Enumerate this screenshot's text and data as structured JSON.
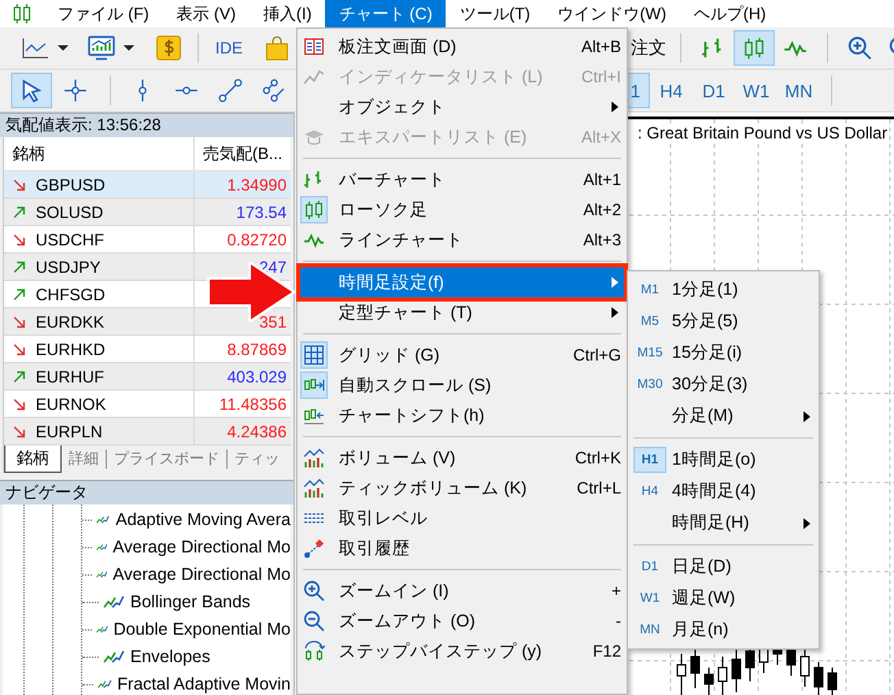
{
  "menu_bar": [
    {
      "label": "ファイル (F)",
      "selected": false
    },
    {
      "label": "表示 (V)",
      "selected": false
    },
    {
      "label": "挿入(I)",
      "selected": false
    },
    {
      "label": "チャート (C)",
      "selected": true
    },
    {
      "label": "ツール(T)",
      "selected": false
    },
    {
      "label": "ウインドウ(W)",
      "selected": false
    },
    {
      "label": "ヘルプ(H)",
      "selected": false
    }
  ],
  "toolbar": {
    "ide_label": "IDE",
    "order_label": "注文",
    "chart_types": [
      {
        "kind": "bar",
        "selected": false
      },
      {
        "kind": "candle",
        "selected": true
      },
      {
        "kind": "line",
        "selected": false
      }
    ]
  },
  "drawing_tools": [
    {
      "kind": "cursor",
      "selected": true
    },
    {
      "kind": "crosshair",
      "selected": false
    },
    {
      "kind": "vline",
      "selected": false
    },
    {
      "kind": "hline",
      "selected": false
    },
    {
      "kind": "trend",
      "selected": false
    },
    {
      "kind": "channel",
      "selected": false
    }
  ],
  "timeframes": [
    {
      "label": "1",
      "selected": true
    },
    {
      "label": "H4",
      "selected": false
    },
    {
      "label": "D1",
      "selected": false
    },
    {
      "label": "W1",
      "selected": false
    },
    {
      "label": "MN",
      "selected": false
    }
  ],
  "market_watch": {
    "title": "気配値表示: 13:56:28",
    "columns": [
      "銘柄",
      "売気配(B..."
    ],
    "rows": [
      {
        "symbol": "GBPUSD",
        "bid": "1.34990",
        "rising": false,
        "selected": true
      },
      {
        "symbol": "SOLUSD",
        "bid": "173.54",
        "rising": true,
        "selected": false
      },
      {
        "symbol": "USDCHF",
        "bid": "0.82720",
        "rising": false,
        "selected": false
      },
      {
        "symbol": "USDJPY",
        "bid": "247",
        "rising": true,
        "selected": false
      },
      {
        "symbol": "CHFSGD",
        "rising": true,
        "selected": false
      },
      {
        "symbol": "EURDKK",
        "bid": "351",
        "rising": false,
        "selected": false
      },
      {
        "symbol": "EURHKD",
        "bid": "8.87869",
        "rising": false,
        "selected": false
      },
      {
        "symbol": "EURHUF",
        "bid": "403.029",
        "rising": true,
        "selected": false
      },
      {
        "symbol": "EURNOK",
        "bid": "11.48356",
        "rising": false,
        "selected": false
      },
      {
        "symbol": "EURPLN",
        "bid": "4.24386",
        "rising": false,
        "selected": false
      }
    ],
    "tabs": [
      {
        "label": "銘柄",
        "selected": true
      },
      {
        "label": "詳細",
        "selected": false
      },
      {
        "label": "プライスボード",
        "selected": false
      },
      {
        "label": "ティッ",
        "selected": false
      }
    ]
  },
  "navigator": {
    "title": "ナビゲータ",
    "indicators": [
      "Adaptive Moving Avera",
      "Average Directional Mo",
      "Average Directional Mo",
      "Bollinger Bands",
      "Double Exponential Mo",
      "Envelopes",
      "Fractal Adaptive Movin"
    ]
  },
  "chart": {
    "title": ": Great Britain Pound vs US Dollar"
  },
  "chart_menu": [
    {
      "kind": "item",
      "label": "板注文画面 (D)",
      "shortcut": "Alt+B",
      "disabled": false,
      "checked": false,
      "submenu": false,
      "selected": false
    },
    {
      "kind": "item",
      "label": "インディケータリスト (L)",
      "shortcut": "Ctrl+I",
      "disabled": true,
      "checked": false,
      "submenu": false,
      "selected": false
    },
    {
      "kind": "item",
      "label": "オブジェクト",
      "disabled": false,
      "checked": false,
      "submenu": true,
      "selected": false
    },
    {
      "kind": "item",
      "label": "エキスパートリスト (E)",
      "shortcut": "Alt+X",
      "disabled": true,
      "checked": false,
      "submenu": false,
      "selected": false
    },
    {
      "kind": "separator"
    },
    {
      "kind": "item",
      "label": "バーチャート",
      "shortcut": "Alt+1",
      "disabled": false,
      "checked": false,
      "submenu": false,
      "selected": false
    },
    {
      "kind": "item",
      "label": "ローソク足",
      "shortcut": "Alt+2",
      "disabled": false,
      "checked": true,
      "submenu": false,
      "selected": false
    },
    {
      "kind": "item",
      "label": "ラインチャート",
      "shortcut": "Alt+3",
      "disabled": false,
      "checked": false,
      "submenu": false,
      "selected": false
    },
    {
      "kind": "separator"
    },
    {
      "kind": "item",
      "label": "時間足設定(f)",
      "disabled": false,
      "checked": false,
      "submenu": true,
      "selected": true,
      "annotated": true
    },
    {
      "kind": "item",
      "label": "定型チャート (T)",
      "disabled": false,
      "checked": false,
      "submenu": true,
      "selected": false
    },
    {
      "kind": "separator"
    },
    {
      "kind": "item",
      "label": "グリッド (G)",
      "shortcut": "Ctrl+G",
      "disabled": false,
      "checked": true,
      "submenu": false,
      "selected": false
    },
    {
      "kind": "item",
      "label": "自動スクロール (S)",
      "disabled": false,
      "checked": true,
      "submenu": false,
      "selected": false
    },
    {
      "kind": "item",
      "label": "チャートシフト(h)",
      "disabled": false,
      "checked": false,
      "submenu": false,
      "selected": false
    },
    {
      "kind": "separator"
    },
    {
      "kind": "item",
      "label": "ボリューム (V)",
      "shortcut": "Ctrl+K",
      "disabled": false,
      "checked": false,
      "submenu": false,
      "selected": false
    },
    {
      "kind": "item",
      "label": "ティックボリューム (K)",
      "shortcut": "Ctrl+L",
      "disabled": false,
      "checked": false,
      "submenu": false,
      "selected": false
    },
    {
      "kind": "item",
      "label": "取引レベル",
      "disabled": false,
      "checked": false,
      "submenu": false,
      "selected": false
    },
    {
      "kind": "item",
      "label": "取引履歴",
      "disabled": false,
      "checked": false,
      "submenu": false,
      "selected": false
    },
    {
      "kind": "separator"
    },
    {
      "kind": "item",
      "label": "ズームイン (I)",
      "shortcut": "+",
      "disabled": false,
      "checked": false,
      "submenu": false,
      "selected": false
    },
    {
      "kind": "item",
      "label": "ズームアウト (O)",
      "shortcut": "-",
      "disabled": false,
      "checked": false,
      "submenu": false,
      "selected": false
    },
    {
      "kind": "item",
      "label": "ステップバイステップ (y)",
      "shortcut": "F12",
      "disabled": false,
      "checked": false,
      "submenu": false,
      "selected": false
    }
  ],
  "timeframe_menu": [
    {
      "kind": "item",
      "badge": "M1",
      "label": "1分足(1)",
      "checked": false,
      "submenu": false
    },
    {
      "kind": "item",
      "badge": "M5",
      "label": "5分足(5)",
      "checked": false,
      "submenu": false
    },
    {
      "kind": "item",
      "badge": "M15",
      "label": "15分足(i)",
      "checked": false,
      "submenu": false
    },
    {
      "kind": "item",
      "badge": "M30",
      "label": "30分足(3)",
      "checked": false,
      "submenu": false
    },
    {
      "kind": "item",
      "label": "分足(M)",
      "submenu": true
    },
    {
      "kind": "separator"
    },
    {
      "kind": "item",
      "badge": "H1",
      "label": "1時間足(o)",
      "checked": true,
      "submenu": false
    },
    {
      "kind": "item",
      "badge": "H4",
      "label": "4時間足(4)",
      "checked": false,
      "submenu": false
    },
    {
      "kind": "item",
      "label": "時間足(H)",
      "submenu": true
    },
    {
      "kind": "separator"
    },
    {
      "kind": "item",
      "badge": "D1",
      "label": "日足(D)",
      "checked": false,
      "submenu": false
    },
    {
      "kind": "item",
      "badge": "W1",
      "label": "週足(W)",
      "checked": false,
      "submenu": false
    },
    {
      "kind": "item",
      "badge": "MN",
      "label": "月足(n)",
      "checked": false,
      "submenu": false
    }
  ]
}
